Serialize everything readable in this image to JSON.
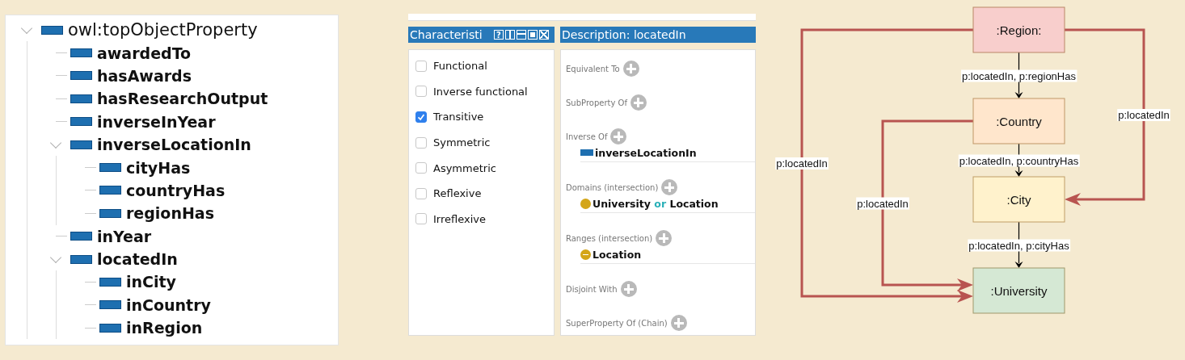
{
  "hierarchy": {
    "root": {
      "label": "owl:topObjectProperty",
      "expanded": true,
      "children": [
        {
          "label": "awardedTo"
        },
        {
          "label": "hasAwards"
        },
        {
          "label": "hasResearchOutput"
        },
        {
          "label": "inverseInYear"
        },
        {
          "label": "inverseLocationIn",
          "expanded": true,
          "children": [
            {
              "label": "cityHas"
            },
            {
              "label": "countryHas"
            },
            {
              "label": "regionHas"
            }
          ]
        },
        {
          "label": "inYear"
        },
        {
          "label": "locatedIn",
          "expanded": true,
          "children": [
            {
              "label": "inCity"
            },
            {
              "label": "inCountry"
            },
            {
              "label": "inRegion"
            }
          ]
        }
      ]
    }
  },
  "characteristics": {
    "title": "Characteristi",
    "help_button": "?",
    "items": [
      {
        "label": "Functional",
        "checked": false
      },
      {
        "label": "Inverse functional",
        "checked": false
      },
      {
        "label": "Transitive",
        "checked": true
      },
      {
        "label": "Symmetric",
        "checked": false
      },
      {
        "label": "Asymmetric",
        "checked": false
      },
      {
        "label": "Reflexive",
        "checked": false
      },
      {
        "label": "Irreflexive",
        "checked": false
      }
    ]
  },
  "description": {
    "title": "Description: locatedIn",
    "sections": [
      {
        "label": "Equivalent To"
      },
      {
        "label": "SubProperty Of"
      },
      {
        "label": "Inverse Of",
        "entries": [
          {
            "kind": "property",
            "parts": [
              {
                "kind": "name",
                "text": "inverseLocationIn"
              }
            ]
          }
        ]
      },
      {
        "label": "Domains (intersection)",
        "entries": [
          {
            "kind": "class",
            "parts": [
              {
                "kind": "name",
                "text": "University"
              },
              {
                "kind": "keyword",
                "text": "or"
              },
              {
                "kind": "name",
                "text": "Location"
              }
            ]
          }
        ]
      },
      {
        "label": "Ranges (intersection)",
        "entries": [
          {
            "kind": "defined_class",
            "parts": [
              {
                "kind": "name",
                "text": "Location"
              }
            ]
          }
        ]
      },
      {
        "label": "Disjoint With"
      },
      {
        "label": "SuperProperty Of (Chain)"
      }
    ]
  },
  "diagram": {
    "nodes": [
      {
        "label": ":Region:",
        "color": "#f8cecc",
        "edges": [
          {
            "kind": "next",
            "label": "p:locatedIn, p:regionHas"
          },
          {
            "kind": "left_to_last",
            "label": "p:locatedIn"
          },
          {
            "kind": "right_skip_one",
            "label": "p:locatedIn"
          }
        ]
      },
      {
        "label": ":Country",
        "color": "#ffe6cc",
        "edges": [
          {
            "kind": "next",
            "label": "p:locatedIn, p:countryHas"
          },
          {
            "kind": "left_to_last",
            "label": "p:locatedIn"
          }
        ]
      },
      {
        "label": ":City",
        "color": "#fff2cc",
        "edges": [
          {
            "kind": "next",
            "label": "p:locatedIn, p:cityHas"
          }
        ]
      },
      {
        "label": ":University",
        "color": "#d5e8d4"
      }
    ]
  }
}
